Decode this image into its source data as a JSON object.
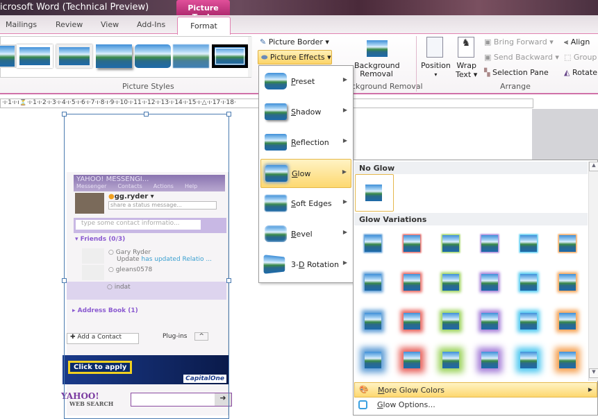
{
  "window": {
    "title": "icrosoft Word (Technical Preview)",
    "context_tab": "Picture Tools"
  },
  "tabs": [
    {
      "label": "Mailings"
    },
    {
      "label": "Review"
    },
    {
      "label": "View"
    },
    {
      "label": "Add-Ins"
    },
    {
      "label": "Format",
      "active": true
    }
  ],
  "ribbon": {
    "picture_styles": {
      "label": "Picture Styles",
      "selected_index": 6
    },
    "picture_border": "Picture Border",
    "picture_effects": "Picture Effects",
    "background_removal": {
      "button_line1": "Background",
      "button_line2": "Removal",
      "group_label": "ckground Removal"
    },
    "arrange": {
      "position": "Position",
      "wrap_line1": "Wrap",
      "wrap_line2": "Text",
      "bring_forward": "Bring Forward",
      "send_backward": "Send Backward",
      "selection_pane": "Selection Pane",
      "align": "Align",
      "group": "Group",
      "rotate": "Rotate",
      "group_label": "Arrange"
    }
  },
  "ruler": {
    "text": "·ı·1·ı·ı⏳·ı·1·ı·2·ı·3·ı·4·ı·5·ı·6·ı·7·ı·8·ı·9·ı·10·ı·11·ı·12·ı·13·ı·14·ı·15·ı·△·ı·17·ı·18·"
  },
  "messenger": {
    "title": "YAHOO! MESSENGI...",
    "menu": [
      "Messenger",
      "Contacts",
      "Actions",
      "Help"
    ],
    "user": "gg.ryder",
    "status_placeholder": "share a status message...",
    "search_placeholder": "type some contact informatio...",
    "friends_header": "Friends (0/3)",
    "contacts": [
      {
        "name": "Gary Ryder",
        "status_prefix": "Update",
        "status": "has updated Relatio ..."
      },
      {
        "name": "gleans0578"
      },
      {
        "name": "indat"
      }
    ],
    "address_book": "Address Book (1)",
    "add_contact": "Add a Contact",
    "plugins": "Plug-ins",
    "ad_button": "Click to apply",
    "ad_brand": "CapitalOne",
    "search_brand": "YAHOO!",
    "search_sub": "WEB SEARCH"
  },
  "effects_menu": {
    "items": [
      {
        "label": "Preset",
        "u": "P",
        "rest": "reset"
      },
      {
        "label": "Shadow",
        "u": "S",
        "rest": "hadow"
      },
      {
        "label": "Reflection",
        "u": "R",
        "rest": "eflection"
      },
      {
        "label": "Glow",
        "u": "G",
        "rest": "low",
        "active": true
      },
      {
        "label": "Soft Edges",
        "u": "S",
        "rest": "oft Edges"
      },
      {
        "label": "Bevel",
        "u": "B",
        "rest": "evel"
      },
      {
        "label": "3-D Rotation",
        "u": "D",
        "pre": "3-",
        "rest": " Rotation"
      }
    ]
  },
  "glow_menu": {
    "no_glow": "No Glow",
    "variations": "Glow Variations",
    "colors": [
      "#5b9bd5",
      "#e8605a",
      "#9bd25a",
      "#a57ed8",
      "#4ec8f0",
      "#f5a050"
    ],
    "rows": 4,
    "more_colors_u": "M",
    "more_colors_rest": "ore Glow Colors",
    "options_u": "G",
    "options_rest": "low Options..."
  }
}
